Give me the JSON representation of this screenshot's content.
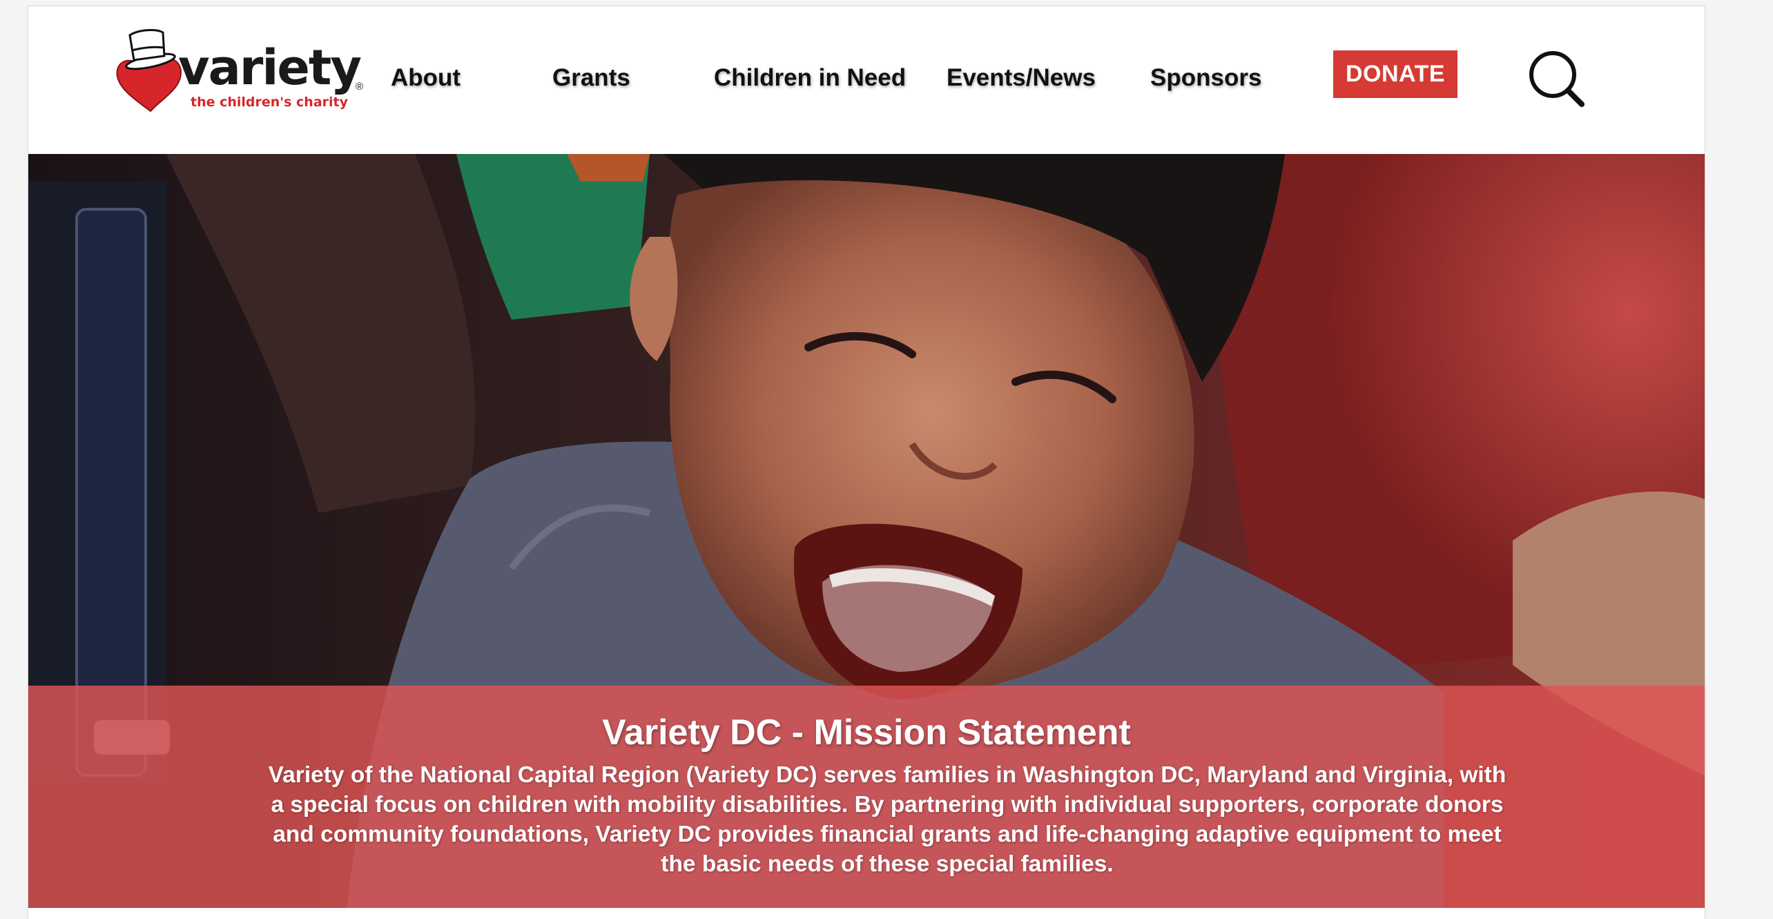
{
  "brand": {
    "name": "variety",
    "registered_mark": "®",
    "tagline": "the children's charity",
    "accent_color": "#d63a34"
  },
  "nav": {
    "items": [
      {
        "label": "About"
      },
      {
        "label": "Grants"
      },
      {
        "label": "Children in Need"
      },
      {
        "label": "Events/News"
      },
      {
        "label": "Sponsors"
      }
    ],
    "donate_label": "DONATE",
    "search_icon": "search-icon"
  },
  "hero": {
    "image_icon": "hero-photo",
    "mission": {
      "title": "Variety DC - Mission Statement",
      "body": "Variety of the National Capital Region (Variety DC) serves families in Washington DC, Maryland and Virginia, with a special focus on children with mobility disabilities.  By partnering with individual supporters, corporate donors and community foundations, Variety DC provides financial grants and life-changing adaptive equipment to meet the basic needs of these special families."
    }
  }
}
